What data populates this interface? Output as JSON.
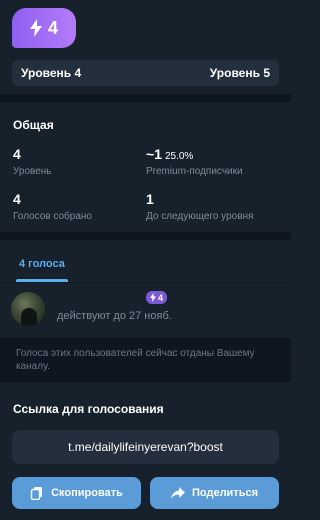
{
  "boost": {
    "count": "4"
  },
  "levels": {
    "current": "Уровень 4",
    "next": "Уровень 5"
  },
  "overview": {
    "title": "Общая",
    "stats": [
      {
        "value": "4",
        "label": "Уровень"
      },
      {
        "value": "~1",
        "extra": "25.0%",
        "label": "Premium-подписчики"
      },
      {
        "value": "4",
        "label": "Голосов собрано"
      },
      {
        "value": "1",
        "label": "До следующего уровня"
      }
    ]
  },
  "tabs": {
    "votes": "4 голоса"
  },
  "voter": {
    "badge": "4",
    "expires": "действуют до 27 нояб."
  },
  "note": "Голоса этих пользователей сейчас отданы Вашему каналу.",
  "link": {
    "title": "Ссылка для голосования",
    "url": "t.me/dailylifeinyerevan?boost"
  },
  "buttons": {
    "copy": "Скопировать",
    "share": "Поделиться"
  },
  "colors": {
    "accent": "#5caff0",
    "boost_purple": "#8f5ff2",
    "button": "#5a9bd8"
  }
}
